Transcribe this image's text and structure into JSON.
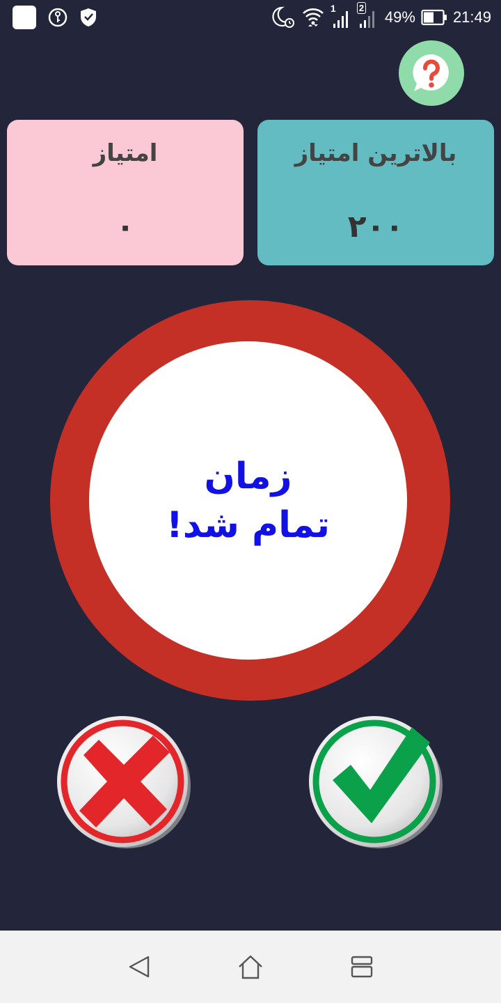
{
  "status_bar": {
    "battery_percent": "49%",
    "time": "21:49",
    "sim1_label": "1",
    "sim2_label": "2",
    "icons": [
      "app-square-icon",
      "key-icon",
      "shield-icon",
      "moon-alarm-icon",
      "wifi-icon",
      "signal-icon",
      "battery-icon"
    ]
  },
  "help": {
    "icon": "question-chat-icon",
    "color": "#8fdcaa"
  },
  "score_card": {
    "title": "امتیاز",
    "value": "۰",
    "color": "#fbc9d5"
  },
  "best_card": {
    "title": "بالاترین امتیاز",
    "value": "۲۰۰",
    "color": "#63bcc2"
  },
  "timer": {
    "line1": "زمان",
    "line2": "تمام شد!",
    "ring_color": "#c42f26",
    "text_color": "#1111e6"
  },
  "answers": {
    "wrong_icon": "red-cross-icon",
    "right_icon": "green-check-icon"
  },
  "nav_bar": {
    "icons": [
      "back-icon",
      "home-icon",
      "recent-apps-icon"
    ]
  }
}
